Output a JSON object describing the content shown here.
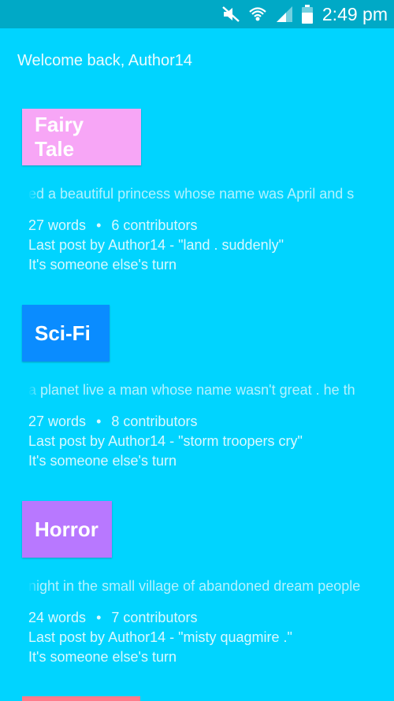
{
  "status_bar": {
    "time": "2:49 pm",
    "icons": [
      "mute-icon",
      "wifi-icon",
      "signal-icon",
      "battery-icon"
    ]
  },
  "welcome_text": "Welcome back, Author14",
  "stories": [
    {
      "genre": "Fairy Tale",
      "genre_color": "#f7a6f6",
      "snippet": "ed a beautiful princess whose name was April and s",
      "word_count": "27 words",
      "contributors": "6 contributors",
      "last_post": "Last post by Author14 - \"land . suddenly\"",
      "turn": "It's someone else's turn"
    },
    {
      "genre": "Sci-Fi",
      "genre_color": "#0a8cff",
      "snippet": "a planet live a man whose name wasn't great . he th",
      "word_count": "27 words",
      "contributors": "8 contributors",
      "last_post": "Last post by Author14 - \"storm troopers cry\"",
      "turn": "It's someone else's turn"
    },
    {
      "genre": "Horror",
      "genre_color": "#b878ff",
      "snippet": "night in the small village of abandoned dream people",
      "word_count": "24 words",
      "contributors": "7 contributors",
      "last_post": "Last post by Author14 - \"misty quagmire .\"",
      "turn": "It's someone else's turn"
    }
  ],
  "colors": {
    "background": "#00d4ff",
    "status_bar": "#00a9c6",
    "partial_next_card": "#ff7b8a"
  }
}
